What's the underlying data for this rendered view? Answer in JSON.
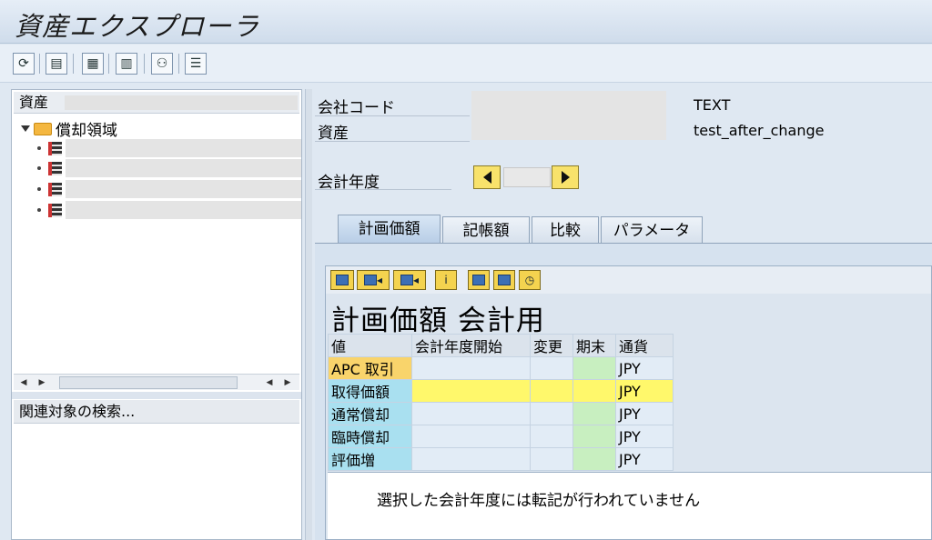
{
  "window": {
    "title": "資産エクスプローラ"
  },
  "toolbar": {
    "icons": [
      "refresh-icon",
      "save-icon",
      "calc-icon",
      "table-icon",
      "people-icon",
      "list-icon"
    ]
  },
  "tree": {
    "header": "資産",
    "root_label": "償却領域",
    "item_count": 4
  },
  "search": {
    "label": "関連対象の検索..."
  },
  "form": {
    "company_code_label": "会社コード",
    "company_code_text": "TEXT",
    "asset_label": "資産",
    "asset_text": "test_after_change",
    "fiscal_year_label": "会計年度"
  },
  "tabs": [
    {
      "label": "計画価額",
      "active": true
    },
    {
      "label": "記帳額",
      "active": false
    },
    {
      "label": "比較",
      "active": false
    },
    {
      "label": "パラメータ",
      "active": false
    }
  ],
  "alv": {
    "title": "計画価額 会計用",
    "columns": [
      "値",
      "会計年度開始",
      "変更",
      "期末",
      "通貨"
    ],
    "rows": [
      {
        "label": "APC 取引",
        "currency": "JPY"
      },
      {
        "label": "取得価額",
        "currency": "JPY"
      },
      {
        "label": "通常償却",
        "currency": "JPY"
      },
      {
        "label": "臨時償却",
        "currency": "JPY"
      },
      {
        "label": "評価増",
        "currency": "JPY"
      }
    ]
  },
  "message": "選択した会計年度には転記が行われていません",
  "colors": {
    "header_row_cyan": "#a9e0f0",
    "header_row_orange": "#f9d46b",
    "highlight_yellow": "#fff86b",
    "end_period_green": "#c8efc0"
  }
}
